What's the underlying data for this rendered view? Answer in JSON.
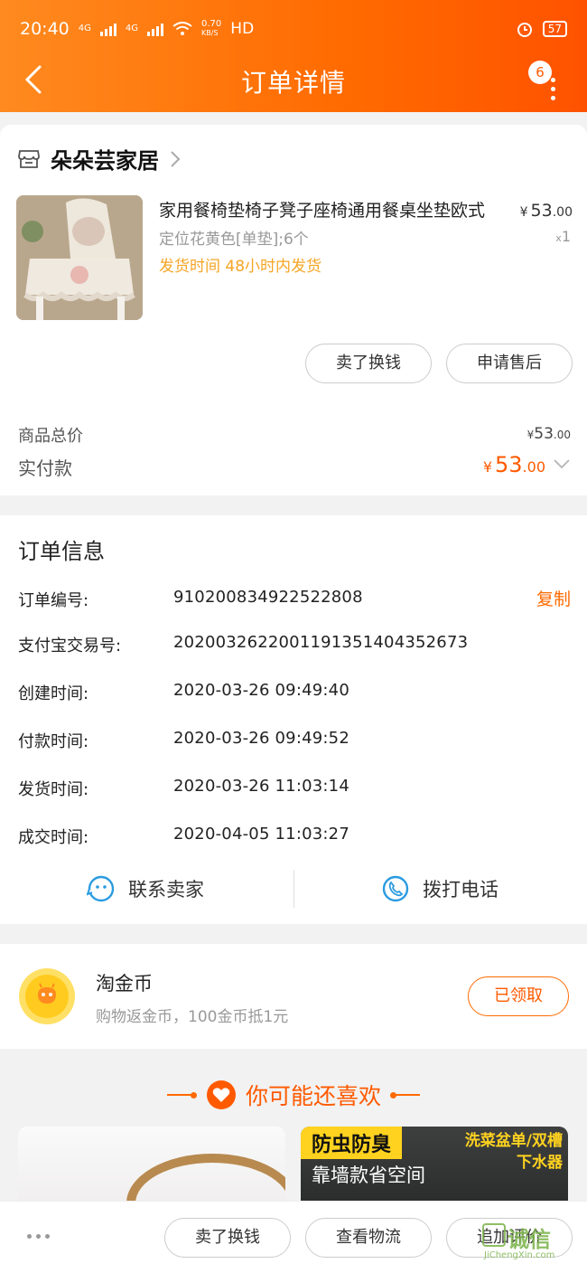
{
  "status_bar": {
    "time": "20:40",
    "network_a": "4G",
    "network_b": "4G",
    "speed": "0.70",
    "speed_unit": "KB/S",
    "hd": "HD",
    "battery": "57"
  },
  "header": {
    "title": "订单详情",
    "badge_count": "6"
  },
  "store": {
    "name": "朵朵芸家居"
  },
  "product": {
    "title": "家用餐椅垫椅子凳子座椅通用餐桌坐垫欧式",
    "spec": "定位花黄色[单垫];6个",
    "ship_time": "发货时间 48小时内发货",
    "price_symbol": "¥",
    "price_int": "53",
    "price_dec": ".00",
    "qty_prefix": "x",
    "qty": "1"
  },
  "item_actions": {
    "sell_label": "卖了换钱",
    "after_sale_label": "申请售后"
  },
  "totals": {
    "goods_total_label": "商品总价",
    "goods_total_symbol": "¥",
    "goods_total_int": "53",
    "goods_total_dec": ".00",
    "paid_label": "实付款",
    "paid_symbol": "¥",
    "paid_int": "53",
    "paid_dec": ".00"
  },
  "order_info": {
    "title": "订单信息",
    "copy_label": "复制",
    "rows": [
      {
        "label": "订单编号:",
        "value": "910200834922522808"
      },
      {
        "label": "支付宝交易号:",
        "value": "2020032622001191351404352673"
      },
      {
        "label": "创建时间:",
        "value": "2020-03-26 09:49:40"
      },
      {
        "label": "付款时间:",
        "value": "2020-03-26 09:49:52"
      },
      {
        "label": "发货时间:",
        "value": "2020-03-26 11:03:14"
      },
      {
        "label": "成交时间:",
        "value": "2020-04-05 11:03:27"
      }
    ]
  },
  "contact": {
    "seller_label": "联系卖家",
    "phone_label": "拨打电话"
  },
  "coins": {
    "title": "淘金币",
    "desc": "购物返金币，100金币抵1元",
    "button_label": "已领取"
  },
  "recommend": {
    "title": "你可能还喜欢",
    "promo_a": "防虫防臭",
    "promo_b": "靠墙款省空间",
    "promo_c1": "洗菜盆单/双槽",
    "promo_c2": "下水器"
  },
  "bottom_bar": {
    "sell_label": "卖了换钱",
    "logistics_label": "查看物流",
    "review_label": "追加评价"
  },
  "watermark": {
    "text": "诚信",
    "url": "JiChengXin.com"
  },
  "colors": {
    "accent": "#ff6a00",
    "ship_time": "#f5a524",
    "coin": "#ffcb1f"
  }
}
